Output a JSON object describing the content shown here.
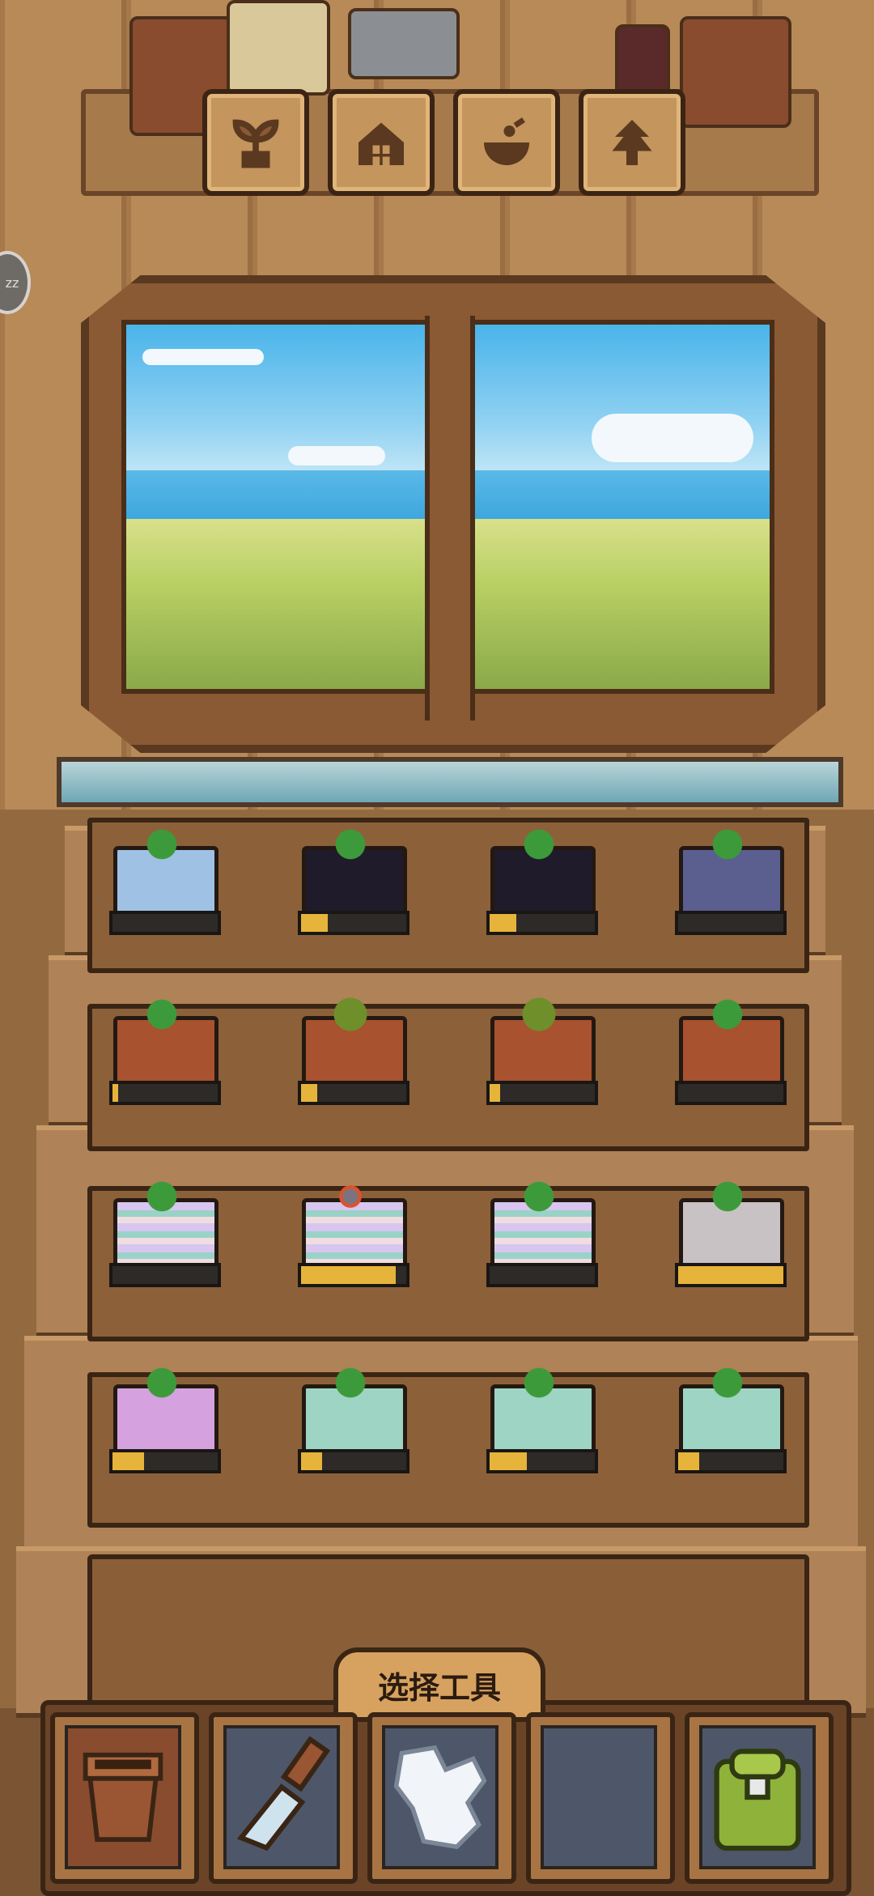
{
  "top_nav": {
    "items": [
      {
        "icon": "sprout-icon"
      },
      {
        "icon": "house-icon"
      },
      {
        "icon": "bowl-icon"
      },
      {
        "icon": "tree-icon"
      }
    ]
  },
  "side": {
    "sleep_icon": "zz-icon",
    "profile_icon": "person-icon"
  },
  "shelves": [
    {
      "row": 1,
      "pots": [
        {
          "pot": "light-blue",
          "plant": "tall-vine",
          "progress": 0.0
        },
        {
          "pot": "cat-ear-black",
          "plant": "curl-sprout",
          "progress": 0.25
        },
        {
          "pot": "cat-ear-black",
          "plant": "curl-sprout",
          "progress": 0.25
        },
        {
          "pot": "slate-blue",
          "plant": "corn-stalk",
          "progress": 0.0
        }
      ]
    },
    {
      "row": 2,
      "pots": [
        {
          "pot": "terracotta",
          "plant": "tall-vine",
          "progress": 0.05
        },
        {
          "pot": "terracotta",
          "plant": "green-tentacles",
          "progress": 0.15
        },
        {
          "pot": "terracotta",
          "plant": "green-tentacles",
          "progress": 0.1
        },
        {
          "pot": "terracotta",
          "plant": "corn-stalk",
          "progress": 0.0
        }
      ]
    },
    {
      "row": 3,
      "pots": [
        {
          "pot": "striped",
          "plant": "broad-leaf",
          "progress": 0.0
        },
        {
          "pot": "striped",
          "plant": "red-bonsai",
          "progress": 0.9
        },
        {
          "pot": "striped",
          "plant": "broad-leaf",
          "progress": 0.0
        },
        {
          "pot": "hexagon-grey",
          "plant": "small-sprout",
          "progress": 1.0
        }
      ]
    },
    {
      "row": 4,
      "pots": [
        {
          "pot": "pink",
          "plant": "seedling",
          "progress": 0.3
        },
        {
          "pot": "mint",
          "plant": "seedling",
          "progress": 0.2
        },
        {
          "pot": "mint",
          "plant": "seedling",
          "progress": 0.35
        },
        {
          "pot": "mint",
          "plant": "seedling",
          "progress": 0.2
        }
      ]
    }
  ],
  "toolbar": {
    "label": "选择工具",
    "tools": [
      {
        "icon": "pot-icon"
      },
      {
        "icon": "trowel-icon"
      },
      {
        "icon": "glove-icon"
      },
      {
        "icon": "empty-slot"
      },
      {
        "icon": "backpack-icon"
      }
    ]
  },
  "colors": {
    "accent": "#e6b43a",
    "frame": "#3a2515"
  }
}
